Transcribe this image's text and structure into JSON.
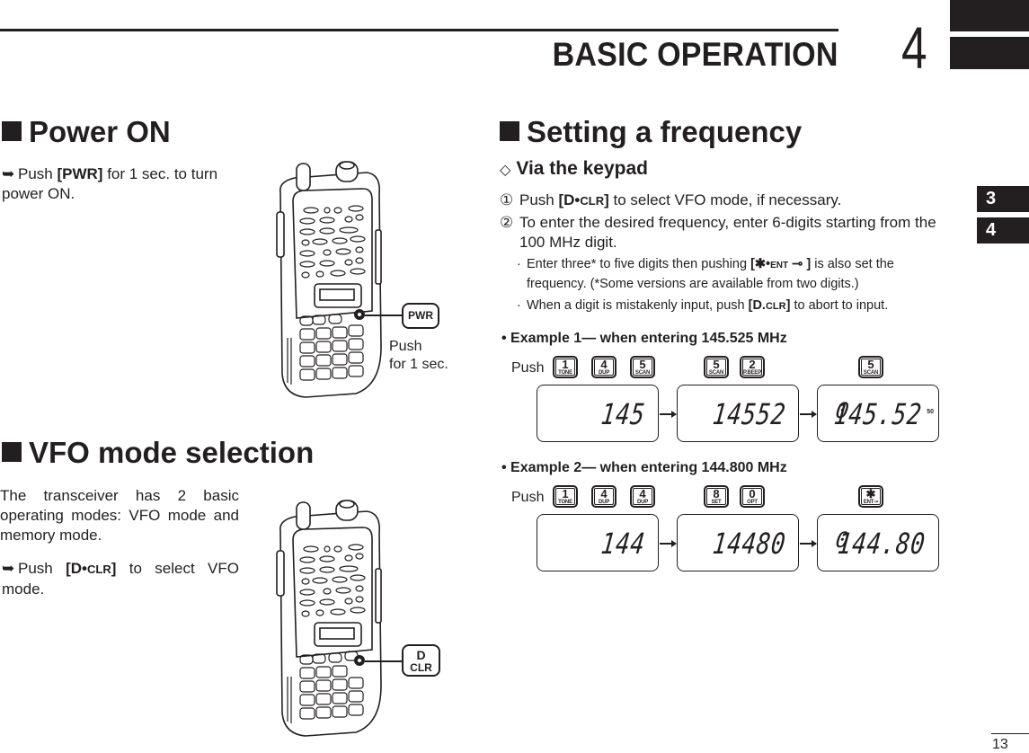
{
  "header": {
    "chapter_title": "BASIC OPERATION",
    "chapter_number": "4",
    "side_tabs": [
      "3",
      "4"
    ],
    "page_number": "13"
  },
  "power_on": {
    "heading": "Power ON",
    "instruction_pre": "Push ",
    "instruction_key": "[PWR]",
    "instruction_post": " for 1 sec. to turn power ON.",
    "badge": "PWR",
    "caption_line1": "Push",
    "caption_line2": "for 1 sec."
  },
  "vfo_mode": {
    "heading": "VFO mode selection",
    "description": "The transceiver has 2 basic operating modes: VFO mode and memory mode.",
    "instruction_pre": "Push ",
    "instruction_key_main": "[D•",
    "instruction_key_small": "CLR",
    "instruction_key_end": "]",
    "instruction_post": " to select VFO mode.",
    "badge_top": "D",
    "badge_bottom": "CLR"
  },
  "setting_frequency": {
    "heading": "Setting a frequency",
    "subheading": "Via the keypad",
    "steps": [
      {
        "num": "①",
        "pre": "Push ",
        "key": "[D•",
        "key_small": "CLR",
        "key_end": "]",
        "post": " to select VFO mode, if necessary."
      },
      {
        "num": "②",
        "text": "To enter the desired frequency, enter 6-digits starting from the 100 MHz digit."
      }
    ],
    "notes": [
      {
        "pre": "Enter three* to five digits then pushing ",
        "key": "[✱•",
        "key_small": "ENT",
        "key_icon": "⊸",
        "key_end": " ]",
        "post": " is also set the frequency. (*Some versions are available from two digits.)"
      },
      {
        "pre": "When a digit is mistakenly input, push ",
        "key": "[D.",
        "key_small": "CLR",
        "key_end": "]",
        "post": " to abort to input."
      }
    ],
    "examples": [
      {
        "title": "Example 1— when entering 145.525 MHz",
        "push_label": "Push",
        "key_groups": [
          [
            {
              "num": "1",
              "label": "TONE"
            },
            {
              "num": "4",
              "label": "DUP"
            },
            {
              "num": "5",
              "label": "SCAN"
            }
          ],
          [
            {
              "num": "5",
              "label": "SCAN"
            },
            {
              "num": "2",
              "label": "P.BEEP"
            }
          ],
          [
            {
              "num": "5",
              "label": "SCAN"
            }
          ]
        ],
        "displays": [
          {
            "memory": "",
            "frequency": "145",
            "sub": ""
          },
          {
            "memory": "",
            "frequency": "14552",
            "sub": ""
          },
          {
            "memory": "0",
            "frequency": "145.52",
            "sub": "50"
          }
        ]
      },
      {
        "title": "Example 2— when entering 144.800 MHz",
        "push_label": "Push",
        "key_groups": [
          [
            {
              "num": "1",
              "label": "TONE"
            },
            {
              "num": "4",
              "label": "DUP"
            },
            {
              "num": "4",
              "label": "DUP"
            }
          ],
          [
            {
              "num": "8",
              "label": "SET"
            },
            {
              "num": "0",
              "label": "OPT"
            }
          ],
          [
            {
              "num": "✱",
              "label": "ENT⊸"
            }
          ]
        ],
        "displays": [
          {
            "memory": "",
            "frequency": "144",
            "sub": ""
          },
          {
            "memory": "",
            "frequency": "14480",
            "sub": ""
          },
          {
            "memory": "0",
            "frequency": "144.80",
            "sub": ""
          }
        ]
      }
    ]
  }
}
